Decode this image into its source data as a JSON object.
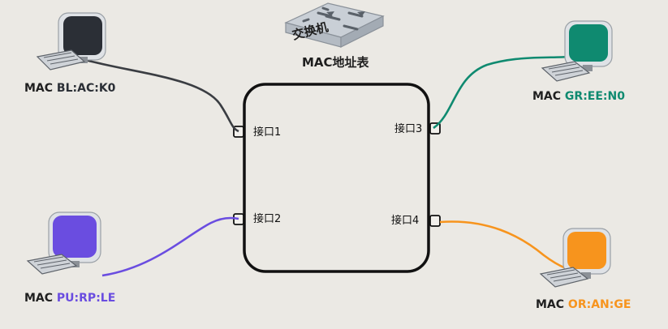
{
  "switch": {
    "name": "交换机",
    "table_label_prefix": "MAC",
    "table_label_suffix": "地址表"
  },
  "ports": [
    {
      "label": "接口1"
    },
    {
      "label": "接口2"
    },
    {
      "label": "接口3"
    },
    {
      "label": "接口4"
    }
  ],
  "computers": [
    {
      "mac_prefix": "MAC",
      "mac_value": "BL:AC:K0",
      "color": "#2b2f36",
      "value_color": "#2b2f36"
    },
    {
      "mac_prefix": "MAC",
      "mac_value": "PU:RP:LE",
      "color": "#6a4de0",
      "value_color": "#6a4de0"
    },
    {
      "mac_prefix": "MAC",
      "mac_value": "GR:EE:N0",
      "color": "#0f8a70",
      "value_color": "#0f8a70"
    },
    {
      "mac_prefix": "MAC",
      "mac_value": "OR:AN:GE",
      "color": "#f7941d",
      "value_color": "#f7941d"
    }
  ]
}
